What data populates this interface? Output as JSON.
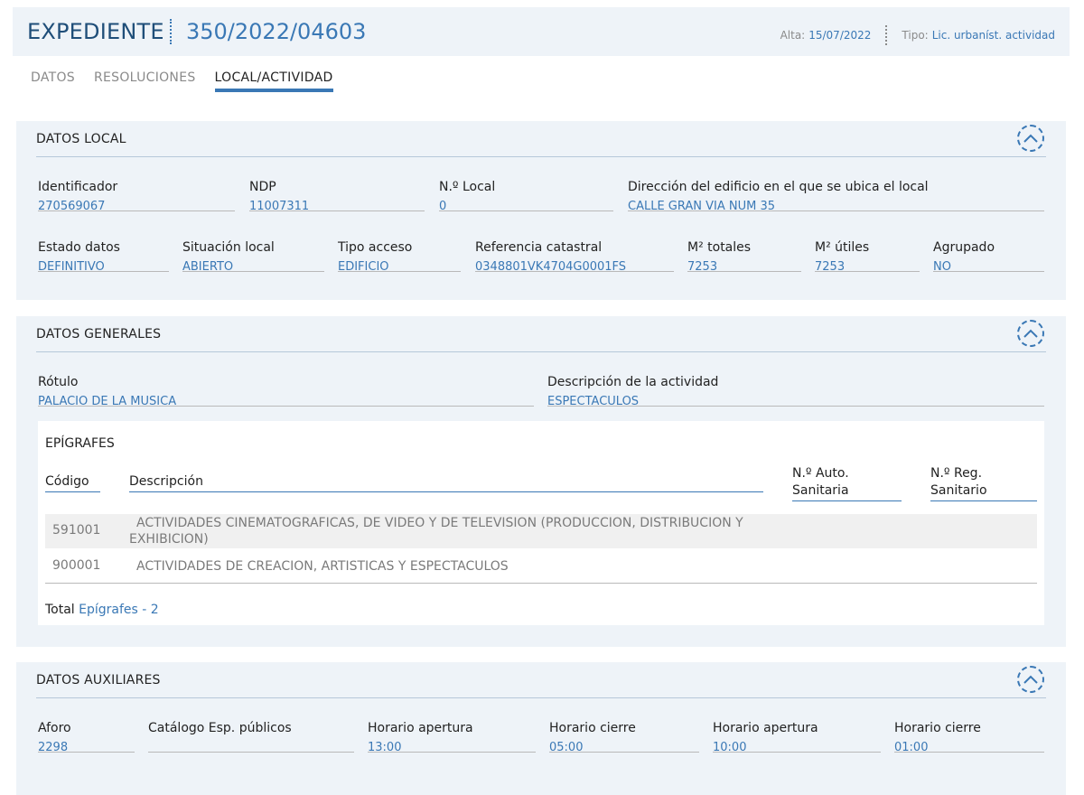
{
  "header": {
    "title": "EXPEDIENTE",
    "number": "350/2022/04603",
    "alta_label": "Alta:",
    "alta_value": "15/07/2022",
    "tipo_label": "Tipo:",
    "tipo_value": "Lic. urbaníst. actividad"
  },
  "tabs": [
    "DATOS",
    "RESOLUCIONES",
    "LOCAL/ACTIVIDAD"
  ],
  "active_tab": "LOCAL/ACTIVIDAD",
  "local": {
    "title": "DATOS LOCAL",
    "row1": [
      {
        "label": "Identificador",
        "value": "270569067"
      },
      {
        "label": "NDP",
        "value": "11007311"
      },
      {
        "label": "N.º Local",
        "value": "0"
      },
      {
        "label": "Dirección del edificio en el que se ubica el local",
        "value": "CALLE GRAN VIA NUM 35"
      }
    ],
    "row2": [
      {
        "label": "Estado datos",
        "value": "DEFINITIVO"
      },
      {
        "label": "Situación local",
        "value": "ABIERTO"
      },
      {
        "label": "Tipo acceso",
        "value": "EDIFICIO"
      },
      {
        "label": "Referencia catastral",
        "value": "0348801VK4704G0001FS"
      },
      {
        "label": "M² totales",
        "value": "7253"
      },
      {
        "label": "M² útiles",
        "value": "7253"
      },
      {
        "label": "Agrupado",
        "value": "NO"
      }
    ]
  },
  "generales": {
    "title": "DATOS GENERALES",
    "fields": [
      {
        "label": "Rótulo",
        "value": "PALACIO DE LA MUSICA"
      },
      {
        "label": "Descripción de la actividad",
        "value": "ESPECTACULOS"
      }
    ],
    "epigrafes": {
      "title": "EPÍGRAFES",
      "headers": {
        "codigo": "Código",
        "descripcion": "Descripción",
        "auto_1": "N.º Auto.",
        "auto_2": "Sanitaria",
        "reg_1": "N.º Reg.",
        "reg_2": "Sanitario"
      },
      "rows": [
        {
          "codigo": "591001",
          "descripcion": "ACTIVIDADES CINEMATOGRAFICAS, DE VIDEO Y DE TELEVISION (PRODUCCION, DISTRIBUCION Y EXHIBICION)"
        },
        {
          "codigo": "900001",
          "descripcion": "ACTIVIDADES DE CREACION, ARTISTICAS Y ESPECTACULOS"
        }
      ],
      "total_label": "Total",
      "total_value": "Epígrafes - 2"
    }
  },
  "auxiliares": {
    "title": "DATOS AUXILIARES",
    "fields": [
      {
        "label": "Aforo",
        "value": "2298"
      },
      {
        "label": "Catálogo Esp. públicos",
        "value": ""
      },
      {
        "label": "Horario apertura",
        "value": "13:00"
      },
      {
        "label": "Horario cierre",
        "value": "05:00"
      },
      {
        "label": "Horario apertura",
        "value": "10:00"
      },
      {
        "label": "Horario cierre",
        "value": "01:00"
      }
    ]
  },
  "colors": {
    "accent": "#3a78b5",
    "panel": "#eef3f8",
    "row_alt": "#f0f0f0"
  },
  "icons": {
    "collapse": "chevron-up-icon"
  }
}
